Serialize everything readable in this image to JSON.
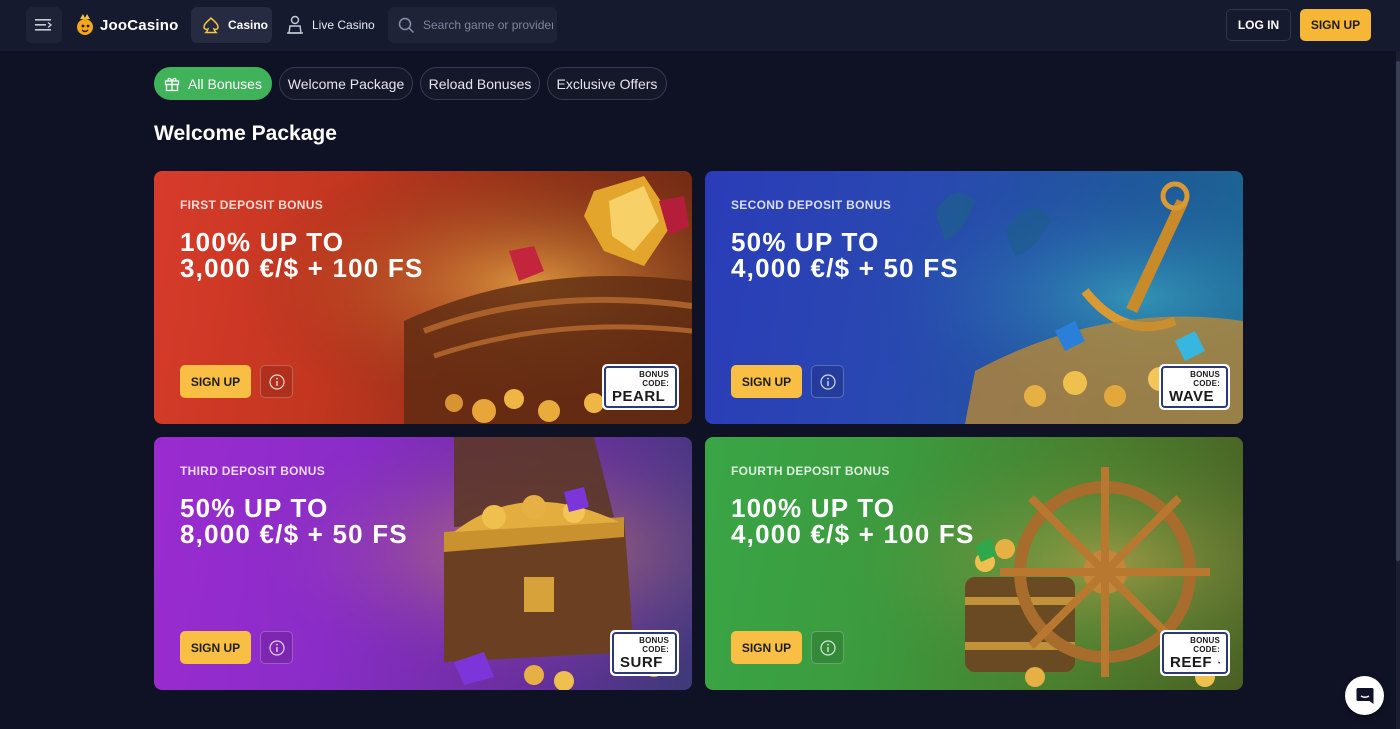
{
  "header": {
    "logo_text": "JooCasino",
    "nav_casino": "Casino",
    "nav_live": "Live Casino",
    "search_placeholder": "Search game or provider",
    "login": "LOG IN",
    "signup": "SIGN UP"
  },
  "tabs": [
    {
      "label": "All Bonuses",
      "active": true
    },
    {
      "label": "Welcome Package",
      "active": false
    },
    {
      "label": "Reload Bonuses",
      "active": false
    },
    {
      "label": "Exclusive Offers",
      "active": false
    }
  ],
  "section_title": "Welcome Package",
  "cards": [
    {
      "label": "FIRST DEPOSIT BONUS",
      "title_line1": "100% UP TO",
      "title_line2": "3,000 €/$ + 100 FS",
      "signup": "SIGN UP",
      "code_label": "BONUS CODE:",
      "code": "PEARL",
      "theme": "red"
    },
    {
      "label": "SECOND DEPOSIT BONUS",
      "title_line1": "50% UP TO",
      "title_line2": "4,000 €/$ + 50 FS",
      "signup": "SIGN UP",
      "code_label": "BONUS CODE:",
      "code": "WAVE",
      "theme": "blue"
    },
    {
      "label": "THIRD DEPOSIT BONUS",
      "title_line1": "50% UP TO",
      "title_line2": "8,000 €/$ + 50 FS",
      "signup": "SIGN UP",
      "code_label": "BONUS CODE:",
      "code": "SURF",
      "theme": "purple"
    },
    {
      "label": "FOURTH DEPOSIT BONUS",
      "title_line1": "100% UP TO",
      "title_line2": "4,000 €/$ + 100 FS",
      "signup": "SIGN UP",
      "code_label": "BONUS CODE:",
      "code": "REEF",
      "theme": "green"
    }
  ],
  "colors": {
    "accent_yellow": "#f7b736",
    "active_tab_green": "#3fb25a",
    "background": "#0e1224"
  }
}
